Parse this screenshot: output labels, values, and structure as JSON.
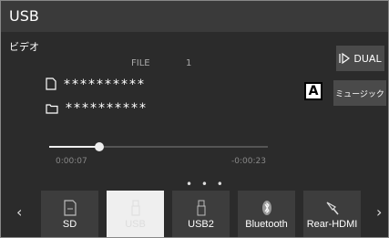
{
  "header": {
    "title": "USB"
  },
  "mode": "ビデオ",
  "file": {
    "label": "FILE",
    "number": "1"
  },
  "rows": [
    "**********",
    "**********"
  ],
  "side_buttons": {
    "dual": "DUAL",
    "music": "ミュージック"
  },
  "callout": "A",
  "progress": {
    "elapsed": "0:00:07",
    "remaining": "-0:00:23",
    "fraction": 0.23
  },
  "page_dots": "• • •",
  "nav": {
    "prev": "‹",
    "next": "›"
  },
  "sources": [
    {
      "label": "SD",
      "icon": "sd-card-icon",
      "selected": false
    },
    {
      "label": "USB",
      "icon": "usb-icon",
      "selected": true
    },
    {
      "label": "USB2",
      "icon": "usb-stick-icon",
      "selected": false
    },
    {
      "label": "Bluetooth",
      "icon": "bluetooth-icon",
      "selected": false
    },
    {
      "label": "Rear-HDMI",
      "icon": "hdmi-icon",
      "selected": false
    }
  ]
}
